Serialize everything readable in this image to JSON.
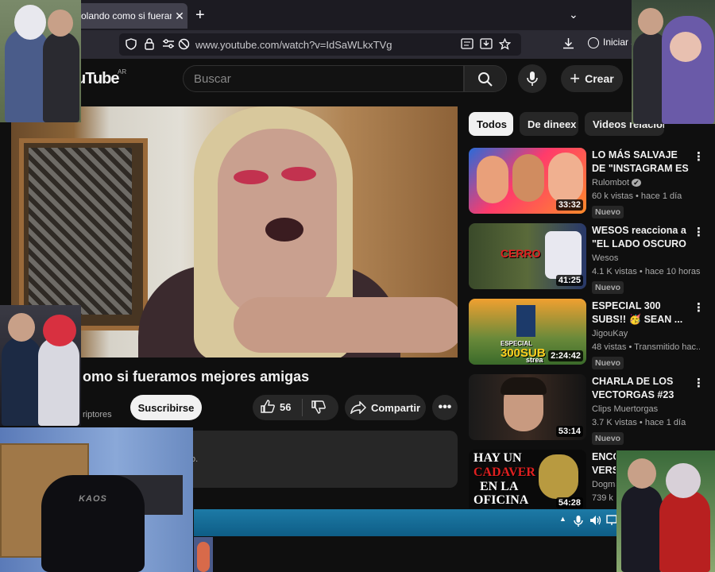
{
  "browser": {
    "tab_title": "olando como si fueramos",
    "tab_close": "✕",
    "new_tab": "+",
    "tab_list": "⌄",
    "url": "www.youtube.com/watch?v=IdSaWLkxTVg",
    "signin_label": "Iniciar s"
  },
  "header": {
    "logo": "uTube",
    "logo_region": "AR",
    "search_placeholder": "Buscar",
    "create_label": "Crear"
  },
  "video": {
    "title": "omo si fueramos mejores amigas",
    "channel_subtext": "riptores",
    "subscribe_label": "Suscribirse",
    "likes": "56",
    "share_label": "Compartir",
    "description_snippet": "o."
  },
  "chips": [
    {
      "label": "Todos"
    },
    {
      "label": "De dineex"
    },
    {
      "label": "Videos relacion"
    }
  ],
  "recommendations": [
    {
      "title": "LO MÁS SALVAJE DE \"INSTAGRAM ES ...",
      "channel": "Rulombot",
      "verified": "✔",
      "meta": "60 k vistas • hace 1 día",
      "badge": "Nuevo",
      "duration": "33:32"
    },
    {
      "title": "WESOS reacciona a \"EL LADO OSCURO ...",
      "channel": "Wesos",
      "meta": "4.1 K vistas • hace 10 horas",
      "badge": "Nuevo",
      "duration": "41:25",
      "thumb_text": "CERRO"
    },
    {
      "title": "ESPECIAL 300 SUBS!! 🥳 SEAN ...",
      "channel": "JigouKay",
      "meta": "48 vistas • Transmitido hac...",
      "badge": "Nuevo",
      "duration": "2:24:42",
      "thumb_text_1": "ESPECIAL",
      "thumb_text_2": "300SUB",
      "thumb_text_3": "strea"
    },
    {
      "title": "CHARLA DE LOS VECTORGAS #23",
      "channel": "Clips Muertorgas",
      "meta": "3.7 K vistas • hace 1 día",
      "badge": "Nuevo",
      "duration": "53:14"
    },
    {
      "title": "ENCO VERS",
      "channel": "Dogma",
      "meta": "739 k",
      "duration": "54:28",
      "thumb_text_1": "HAY UN",
      "thumb_text_2": "CADAVER",
      "thumb_text_3": "EN LA",
      "thumb_text_4": "OFICINA"
    }
  ],
  "overlay": {
    "chair_text": "KAOS"
  },
  "colors": {
    "background": "#0f0f0f",
    "chip_active": "#f1f1f1",
    "taskbar": "#1d7aa6",
    "thumb_red_text": "#e02020"
  },
  "icons": [
    "shield-icon",
    "lock-icon",
    "permissions-icon",
    "tracking-icon",
    "search-icon",
    "mic-icon",
    "plus-icon",
    "like-icon",
    "dislike-icon",
    "share-icon",
    "more-icon",
    "download-icon",
    "account-icon",
    "bookmark-icon"
  ]
}
